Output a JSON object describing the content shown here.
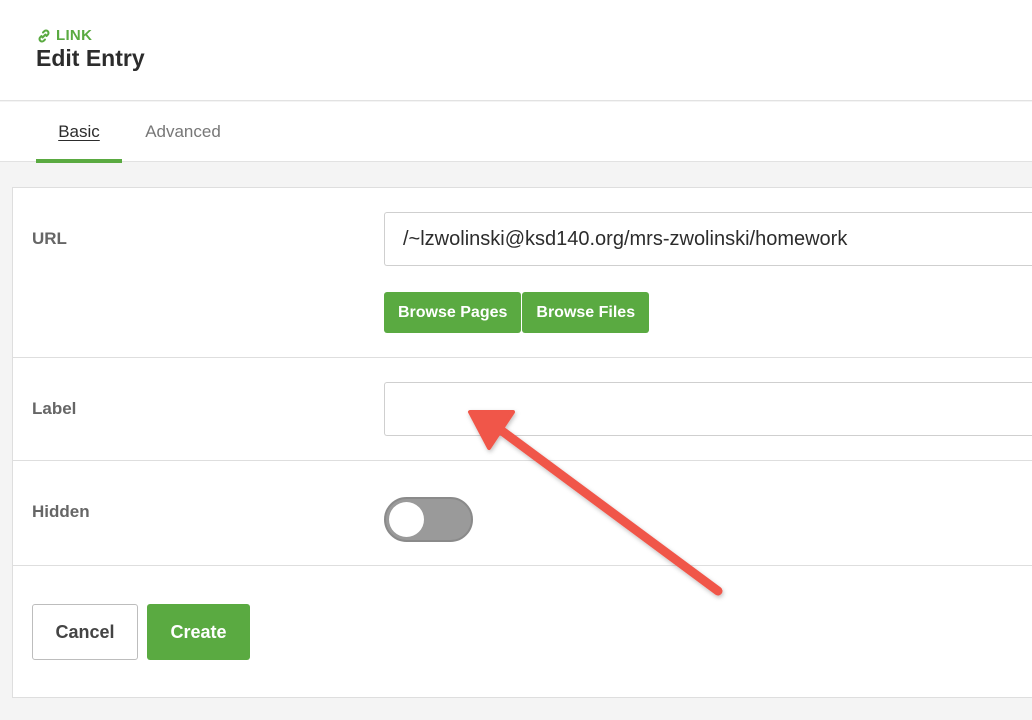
{
  "header": {
    "eyebrow": "LINK",
    "eyebrow_icon": "link-icon",
    "title": "Edit Entry",
    "accent_color": "#5aaa41"
  },
  "tabs": [
    {
      "label": "Basic",
      "active": true
    },
    {
      "label": "Advanced",
      "active": false
    }
  ],
  "form": {
    "url": {
      "label": "URL",
      "value": "/~lzwolinski@ksd140.org/mrs-zwolinski/homework",
      "buttons": [
        "Browse Pages",
        "Browse Files"
      ]
    },
    "label_field": {
      "label": "Label",
      "value": ""
    },
    "hidden": {
      "label": "Hidden",
      "on": false
    }
  },
  "actions": {
    "cancel": "Cancel",
    "create": "Create"
  },
  "annotation": {
    "type": "arrow",
    "color": "#f0564a",
    "points_to": "label-input"
  }
}
